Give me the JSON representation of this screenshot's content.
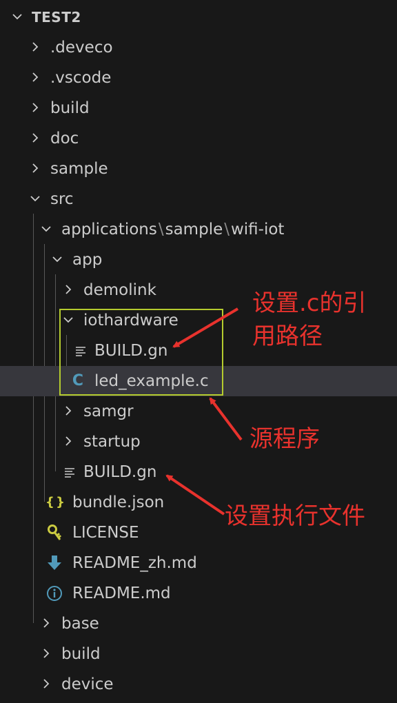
{
  "explorer": {
    "root": "TEST2",
    "items": [
      {
        "label": ".deveco"
      },
      {
        "label": ".vscode"
      },
      {
        "label": "build"
      },
      {
        "label": "doc"
      },
      {
        "label": "sample"
      },
      {
        "label": "src"
      },
      {
        "path": [
          "applications",
          "sample",
          "wifi-iot"
        ],
        "separator": "\\"
      },
      {
        "label": "app"
      },
      {
        "label": "demolink"
      },
      {
        "label": "iothardware"
      },
      {
        "label": "BUILD.gn"
      },
      {
        "label": "led_example.c",
        "icon_glyph": "C",
        "selected": true
      },
      {
        "label": "samgr"
      },
      {
        "label": "startup"
      },
      {
        "label": "BUILD.gn"
      },
      {
        "label": "bundle.json",
        "icon_glyph": "{ }"
      },
      {
        "label": "LICENSE"
      },
      {
        "label": "README_zh.md"
      },
      {
        "label": "README.md"
      },
      {
        "label": "base"
      },
      {
        "label": "build"
      },
      {
        "label": "device"
      }
    ]
  },
  "annotations": {
    "include_path_line1": "设置.c的引",
    "include_path_line2": "用路径",
    "source_program": "源程序",
    "set_executable": "设置执行文件"
  },
  "colors": {
    "background": "#181818",
    "selected_row": "#37373d",
    "annotation_red": "#e8322d",
    "highlight_box": "#b5cc2e",
    "c_icon": "#519aba",
    "json_icon": "#cbcb41",
    "license_icon": "#cbcb41",
    "readme_zh_icon": "#519aba",
    "readme_icon": "#519aba"
  },
  "icons": {
    "collapsed": "chevron-right-icon",
    "expanded": "chevron-down-icon",
    "gn_file": "lines-icon",
    "c_file": "c-language-icon",
    "json_file": "json-braces-icon",
    "license_file": "key-icon",
    "markdown_zh": "download-arrow-icon",
    "markdown_info": "info-icon"
  }
}
